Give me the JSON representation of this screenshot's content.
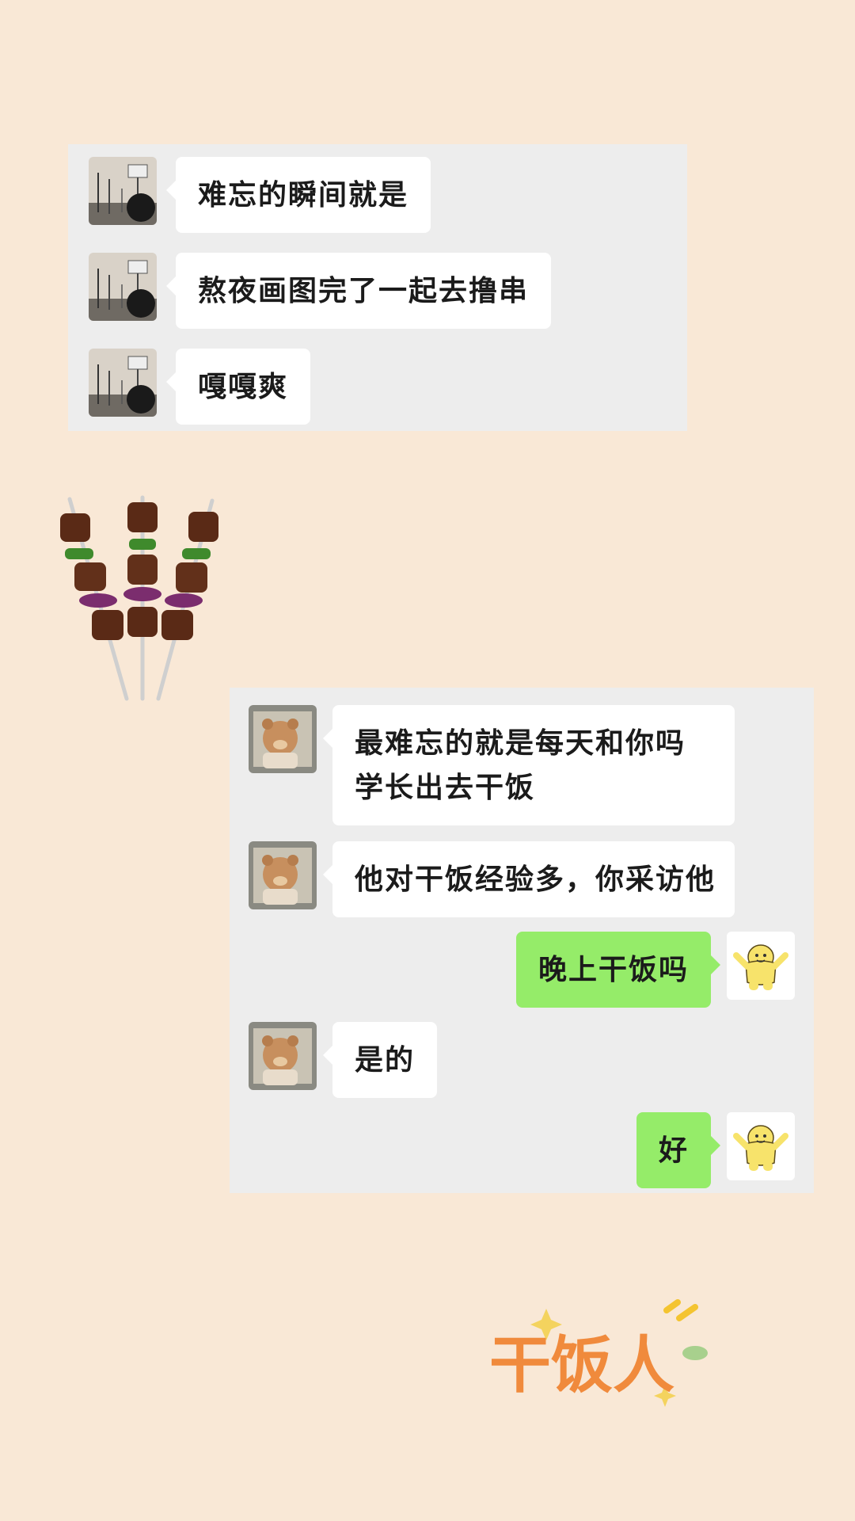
{
  "colors": {
    "background": "#f9e8d6",
    "panel": "#ededed",
    "bubble_in": "#ffffff",
    "bubble_out": "#95ec69",
    "logo": "#f08a3c"
  },
  "chat1": {
    "messages": [
      {
        "sender": "other",
        "avatar": "basketball-hoop-avatar",
        "text": "难忘的瞬间就是"
      },
      {
        "sender": "other",
        "avatar": "basketball-hoop-avatar",
        "text": "熬夜画图完了一起去撸串"
      },
      {
        "sender": "other",
        "avatar": "basketball-hoop-avatar",
        "text": "嘎嘎爽"
      }
    ]
  },
  "chat2": {
    "messages": [
      {
        "sender": "other",
        "avatar": "bear-avatar",
        "text": "最难忘的就是每天和你吗学长出去干饭"
      },
      {
        "sender": "other",
        "avatar": "bear-avatar",
        "text": "他对干饭经验多，你采访他"
      },
      {
        "sender": "self",
        "avatar": "yellow-figure-avatar",
        "text": "晚上干饭吗"
      },
      {
        "sender": "other",
        "avatar": "bear-avatar",
        "text": "是的"
      },
      {
        "sender": "self",
        "avatar": "yellow-figure-avatar",
        "text": "好"
      }
    ]
  },
  "decor": {
    "sticker": "kebab-skewers-icon",
    "logo_text": "干饭人"
  }
}
